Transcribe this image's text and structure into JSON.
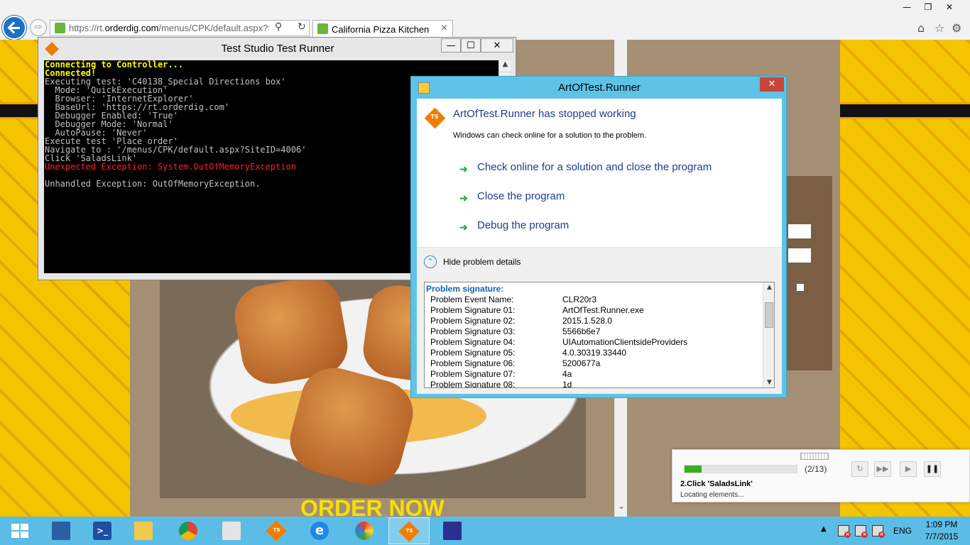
{
  "browser": {
    "address": {
      "scheme": "https://rt.",
      "domain": "orderdig.com",
      "path": "/menus/CPK/default.aspx?SiteI"
    },
    "tab": {
      "title": "California Pizza Kitchen",
      "close": "×"
    },
    "forward_glyph": "⇨",
    "search_glyph": "⚲",
    "refresh_glyph": "↻",
    "window_controls": {
      "minimize": "—",
      "maximize": "❐",
      "close": "✕"
    },
    "toolbar_icons": {
      "home": "⌂",
      "favorites": "☆",
      "settings": "⚙"
    }
  },
  "webpage": {
    "banner": "ORDER NOW",
    "scroll_down": "⌄",
    "brand_color": "#f5c400"
  },
  "test_runner": {
    "title": "Test Studio Test Runner",
    "controls": {
      "minimize": "—",
      "maximize": "☐",
      "close": "✕"
    },
    "scroll_up": "▲",
    "console_lines": [
      {
        "text": "Connecting to Controller...",
        "style": "yellow"
      },
      {
        "text": "Connected!",
        "style": "yellow"
      },
      {
        "text": "Executing test: 'C40138_Special Directions box'",
        "style": "normal"
      },
      {
        "text": "  Mode: 'QuickExecution'",
        "style": "normal"
      },
      {
        "text": "  Browser: 'InternetExplorer'",
        "style": "normal"
      },
      {
        "text": "  BaseUrl: 'https://rt.orderdig.com'",
        "style": "normal"
      },
      {
        "text": "  Debugger Enabled: 'True'",
        "style": "normal"
      },
      {
        "text": "  Debugger Mode: 'Normal'",
        "style": "normal"
      },
      {
        "text": "  AutoPause: 'Never'",
        "style": "normal"
      },
      {
        "text": "Execute test 'Place order'",
        "style": "normal"
      },
      {
        "text": "Navigate to : '/menus/CPK/default.aspx?SiteID=4006'",
        "style": "normal"
      },
      {
        "text": "Click 'SaladsLink'",
        "style": "normal"
      },
      {
        "text": "Unexpected Exception: System.OutOfMemoryException",
        "style": "red"
      },
      {
        "text": "",
        "style": "blank"
      },
      {
        "text": "Unhandled Exception: OutOfMemoryException.",
        "style": "normal"
      }
    ]
  },
  "crash_dialog": {
    "title": "ArtOfTest.Runner",
    "close": "✕",
    "ts_badge": "TS",
    "heading": "ArtOfTest.Runner has stopped working",
    "subtext": "Windows can check online for a solution to the problem.",
    "arrow_glyph": "➜",
    "options": [
      "Check online for a solution and close the program",
      "Close the program",
      "Debug the program"
    ],
    "details_chevron": "⌃",
    "details_toggle": "Hide problem details",
    "problem_header": "Problem signature:",
    "problem_rows": [
      {
        "key": "Problem Event Name:",
        "value": "CLR20r3"
      },
      {
        "key": "Problem Signature 01:",
        "value": "ArtOfTest.Runner.exe"
      },
      {
        "key": "Problem Signature 02:",
        "value": "2015.1.528.0"
      },
      {
        "key": "Problem Signature 03:",
        "value": "5566b6e7"
      },
      {
        "key": "Problem Signature 04:",
        "value": "UIAutomationClientsideProviders"
      },
      {
        "key": "Problem Signature 05:",
        "value": "4.0.30319.33440"
      },
      {
        "key": "Problem Signature 06:",
        "value": "5200677a"
      },
      {
        "key": "Problem Signature 07:",
        "value": "4a"
      },
      {
        "key": "Problem Signature 08:",
        "value": "1d"
      }
    ],
    "scroll_up": "▲",
    "scroll_down": "▼",
    "accent_color": "#5fc3e8"
  },
  "progress_widget": {
    "progress_fraction": 0.15,
    "counter": "(2/13)",
    "step": "2.Click 'SaladsLink'",
    "status": "Locating elements...",
    "buttons": {
      "restart": "↻",
      "skip": "▶▶",
      "play": "▶",
      "pause": "❚❚"
    },
    "fill_color": "#36b021"
  },
  "taskbar": {
    "ts_label": "TS",
    "ps_label": ">_",
    "ie_label": "e",
    "tray_chevron": "▲",
    "tray_x": "×",
    "language": "ENG",
    "time": "1:09 PM",
    "date": "7/7/2015"
  }
}
